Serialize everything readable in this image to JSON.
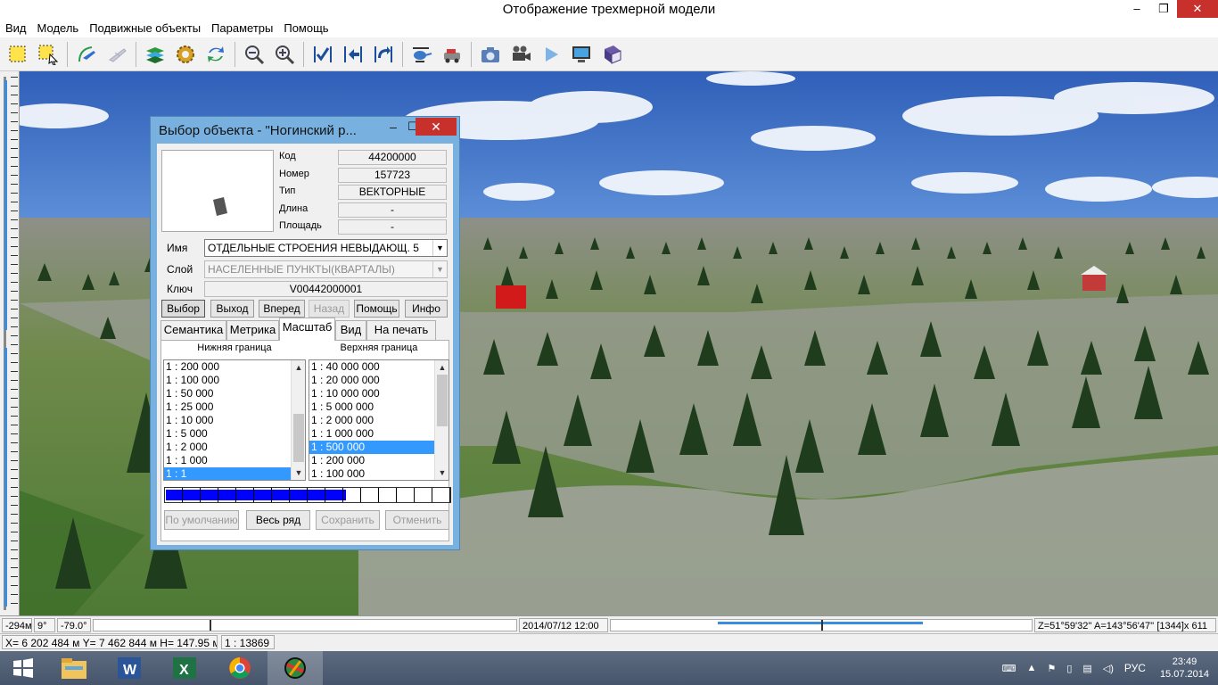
{
  "window": {
    "title": "Отображение трехмерной модели",
    "min": "–",
    "max": "❐",
    "close": "✕"
  },
  "menu": [
    "Вид",
    "Модель",
    "Подвижные объекты",
    "Параметры",
    "Помощь"
  ],
  "toolbar": [
    "select-rect-icon",
    "select-cursor-icon",
    "plane-route-icon",
    "plane-icon",
    "layers-icon",
    "settings-gear-icon",
    "refresh-icon",
    "zoom-out-icon",
    "zoom-in-icon",
    "check-icon",
    "back-arrow-icon",
    "rotate-icon",
    "helicopter-icon",
    "vehicle-icon",
    "camera-icon",
    "video-camera-icon",
    "play-icon",
    "monitor-icon",
    "book-icon"
  ],
  "dialog": {
    "title": "Выбор объекта - \"Ногинский р...",
    "props": [
      {
        "label": "Код",
        "value": "44200000"
      },
      {
        "label": "Номер",
        "value": "157723"
      },
      {
        "label": "Тип",
        "value": "ВЕКТОРНЫЕ"
      },
      {
        "label": "Длина",
        "value": "-"
      },
      {
        "label": "Площадь",
        "value": "-"
      }
    ],
    "name_label": "Имя",
    "name_value": "ОТДЕЛЬНЫЕ СТРОЕНИЯ НЕВЫДАЮЩ. 5",
    "layer_label": "Слой",
    "layer_value": "НАСЕЛЕННЫЕ ПУНКТЫ(КВАРТАЛЫ)",
    "key_label": "Ключ",
    "key_value": "V00442000001",
    "buttons": [
      "Выбор",
      "Выход",
      "Вперед",
      "Назад",
      "Помощь",
      "Инфо"
    ],
    "tabs": [
      "Семантика",
      "Метрика",
      "Масштаб",
      "Вид",
      "На печать"
    ],
    "lower_header": "Нижняя граница",
    "upper_header": "Верхняя граница",
    "lower_list": [
      "1 : 200 000",
      "1 : 100 000",
      "1 : 50 000",
      "1 : 25 000",
      "1 : 10 000",
      "1 : 5 000",
      "1 : 2 000",
      "1 : 1 000",
      "1 : 1"
    ],
    "lower_selected": 8,
    "upper_list": [
      "1 : 40 000 000",
      "1 : 20 000 000",
      "1 : 10 000 000",
      "1 : 5 000 000",
      "1 : 2 000 000",
      "1 : 1 000 000",
      "1 : 500 000",
      "1 : 200 000",
      "1 : 100 000"
    ],
    "upper_selected": 6,
    "scale_fill_fraction": 0.63,
    "bottom_buttons": [
      "По умолчанию",
      "Весь ряд",
      "Сохранить",
      "Отменить"
    ]
  },
  "status1": {
    "dist": "-294м",
    "angle": "9°",
    "tilt": "-79.0°",
    "datetime": "2014/07/12  12:00",
    "coords": "Z=51°59'32''  A=143°56'47''  [1344]x 611"
  },
  "status2": {
    "pos": "X= 6 202 484 м  Y= 7 462 844 м  H= 147.95 м",
    "scale": "1 : 13869"
  },
  "taskbar": {
    "lang": "РУС",
    "time": "23:49",
    "date": "15.07.2014"
  },
  "colors": {
    "accent": "#3399ff",
    "close": "#c7302b",
    "dialog_frame": "#78b1e0"
  }
}
